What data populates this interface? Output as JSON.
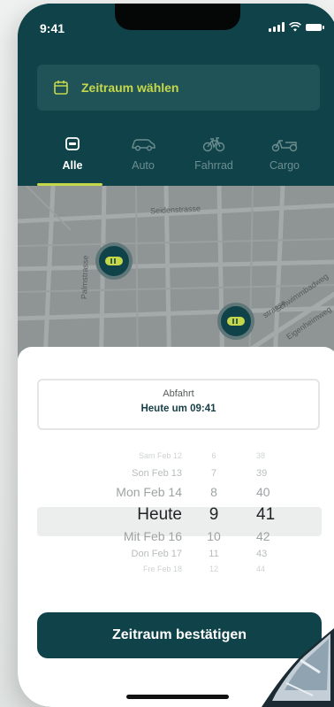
{
  "status_bar": {
    "time": "9:41"
  },
  "header": {
    "date_button_label": "Zeitraum wählen",
    "tabs": [
      {
        "label": "Alle",
        "icon": "all-vehicles-icon",
        "active": true
      },
      {
        "label": "Auto",
        "icon": "car-icon",
        "active": false
      },
      {
        "label": "Fahrrad",
        "icon": "bicycle-icon",
        "active": false
      },
      {
        "label": "Cargo",
        "icon": "cargo-bike-icon",
        "active": false
      }
    ]
  },
  "map": {
    "street_labels": [
      "Seidenstrasse",
      "Palmstrasse",
      "strasse",
      "Schwimmbadweg",
      "Eigenheimweg"
    ]
  },
  "sheet": {
    "departure_label": "Abfahrt",
    "departure_value": "Heute um 09:41",
    "picker": {
      "rows": [
        {
          "date": "Sam Feb 12",
          "hour": "6",
          "minute": "38"
        },
        {
          "date": "Son Feb 13",
          "hour": "7",
          "minute": "39"
        },
        {
          "date": "Mon Feb 14",
          "hour": "8",
          "minute": "40"
        },
        {
          "date": "Heute",
          "hour": "9",
          "minute": "41"
        },
        {
          "date": "Mit Feb 16",
          "hour": "10",
          "minute": "42"
        },
        {
          "date": "Don Feb 17",
          "hour": "11",
          "minute": "43"
        },
        {
          "date": "Fre Feb 18",
          "hour": "12",
          "minute": "44"
        }
      ],
      "selected_index": 3
    },
    "confirm_label": "Zeitraum bestätigen"
  },
  "colors": {
    "primary": "#0f4349",
    "accent": "#c6d84a",
    "map_gray": "#8f9494"
  }
}
